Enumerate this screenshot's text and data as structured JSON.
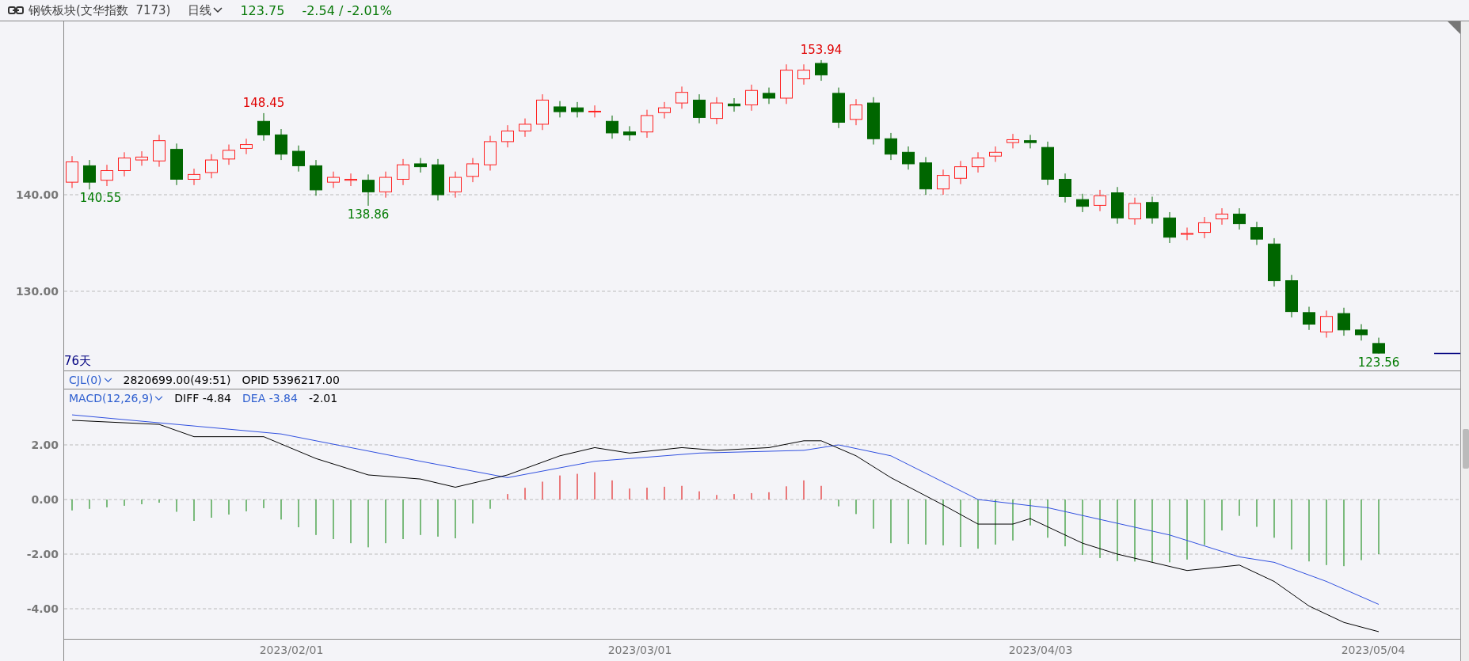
{
  "header": {
    "index_name": "钢铁板块(文华指数  7173)",
    "period": "日线",
    "price": "123.75",
    "change": "-2.54 / -2.01%"
  },
  "price_axis": [
    "140.00",
    "130.00"
  ],
  "annotations": [
    {
      "kind": "high",
      "text": "148.45"
    },
    {
      "kind": "high",
      "text": "153.94"
    },
    {
      "kind": "low",
      "text": "140.55"
    },
    {
      "kind": "low",
      "text": "138.86"
    },
    {
      "kind": "low",
      "text": "123.56"
    }
  ],
  "day_count": "76天",
  "volume_row": {
    "indicator": "CJL(0)",
    "volume": "2820699.00(49:51)",
    "opid": "OPID 5396217.00"
  },
  "macd_row": {
    "indicator": "MACD(12,26,9)",
    "diff": "DIFF -4.84",
    "dea": "DEA -3.84",
    "macd": "-2.01"
  },
  "macd_axis": [
    "2.00",
    "0.00",
    "-2.00",
    "-4.00"
  ],
  "date_axis": [
    "2023/02/01",
    "2023/03/01",
    "2023/04/03",
    "2023/05/04"
  ]
}
